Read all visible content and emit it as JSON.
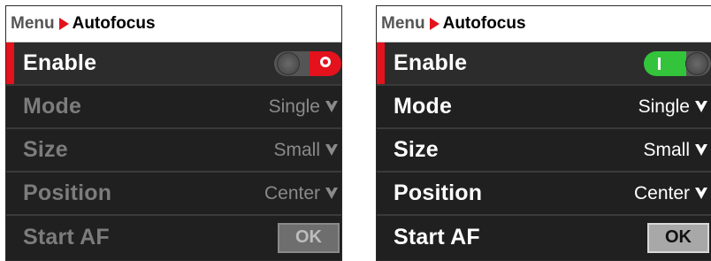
{
  "panels": [
    {
      "state": "disabled",
      "breadcrumb": {
        "root": "Menu",
        "current": "Autofocus"
      },
      "rows": {
        "enable": {
          "label": "Enable",
          "toggle": "off"
        },
        "mode": {
          "label": "Mode",
          "value": "Single"
        },
        "size": {
          "label": "Size",
          "value": "Small"
        },
        "position": {
          "label": "Position",
          "value": "Center"
        },
        "start_af": {
          "label": "Start AF",
          "button": "OK"
        }
      }
    },
    {
      "state": "enabled",
      "breadcrumb": {
        "root": "Menu",
        "current": "Autofocus"
      },
      "rows": {
        "enable": {
          "label": "Enable",
          "toggle": "on"
        },
        "mode": {
          "label": "Mode",
          "value": "Single"
        },
        "size": {
          "label": "Size",
          "value": "Small"
        },
        "position": {
          "label": "Position",
          "value": "Center"
        },
        "start_af": {
          "label": "Start AF",
          "button": "OK"
        }
      }
    }
  ],
  "colors": {
    "accent_red": "#e3121c",
    "toggle_on_green": "#33c43c",
    "background": "#202020",
    "disabled_text": "#7c7c7c"
  },
  "icons": {
    "breadcrumb_separator": "chevron-right-icon",
    "dropdown": "chevron-down-icon",
    "toggle_knob": "toggle-knob-icon"
  }
}
